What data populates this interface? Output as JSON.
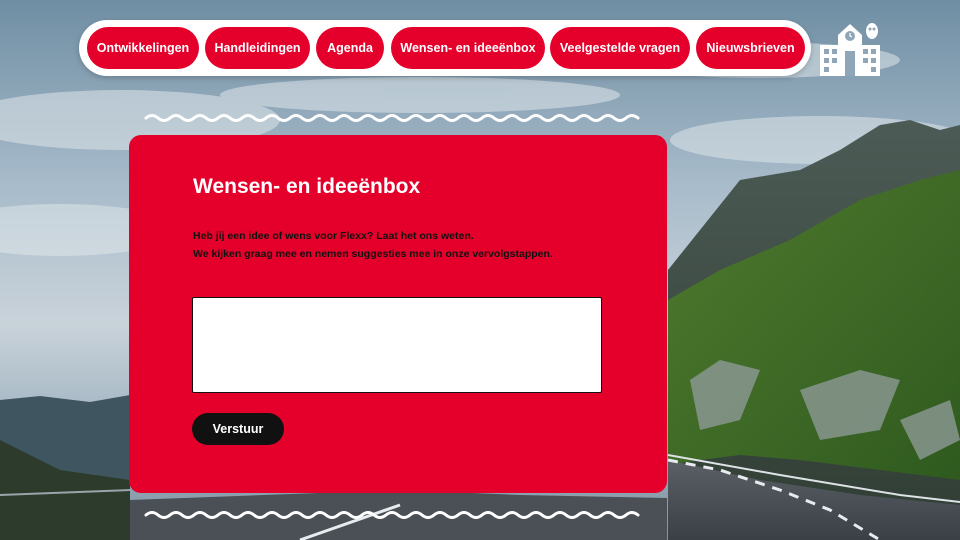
{
  "nav": {
    "items": [
      {
        "label": "Ontwikkelingen"
      },
      {
        "label": "Handleidingen"
      },
      {
        "label": "Agenda"
      },
      {
        "label": "Wensen- en ideeënbox"
      },
      {
        "label": "Veelgestelde vragen"
      },
      {
        "label": "Nieuwsbrieven"
      }
    ],
    "home_icon": "school-building-icon"
  },
  "main": {
    "title": "Wensen- en ideeënbox",
    "description_lines": [
      "Heb jij een idee of wens voor Flexx? Laat het ons weten.",
      "We kijken graag mee en nemen suggesties mee in onze vervolgstappen."
    ],
    "input": {
      "value": "",
      "placeholder": ""
    },
    "submit_label": "Verstuur"
  },
  "colors": {
    "accent": "#e4002b",
    "button_dark": "#111111",
    "nav_background": "#ffffff"
  },
  "background": {
    "scene": "mountain-road-photo"
  }
}
